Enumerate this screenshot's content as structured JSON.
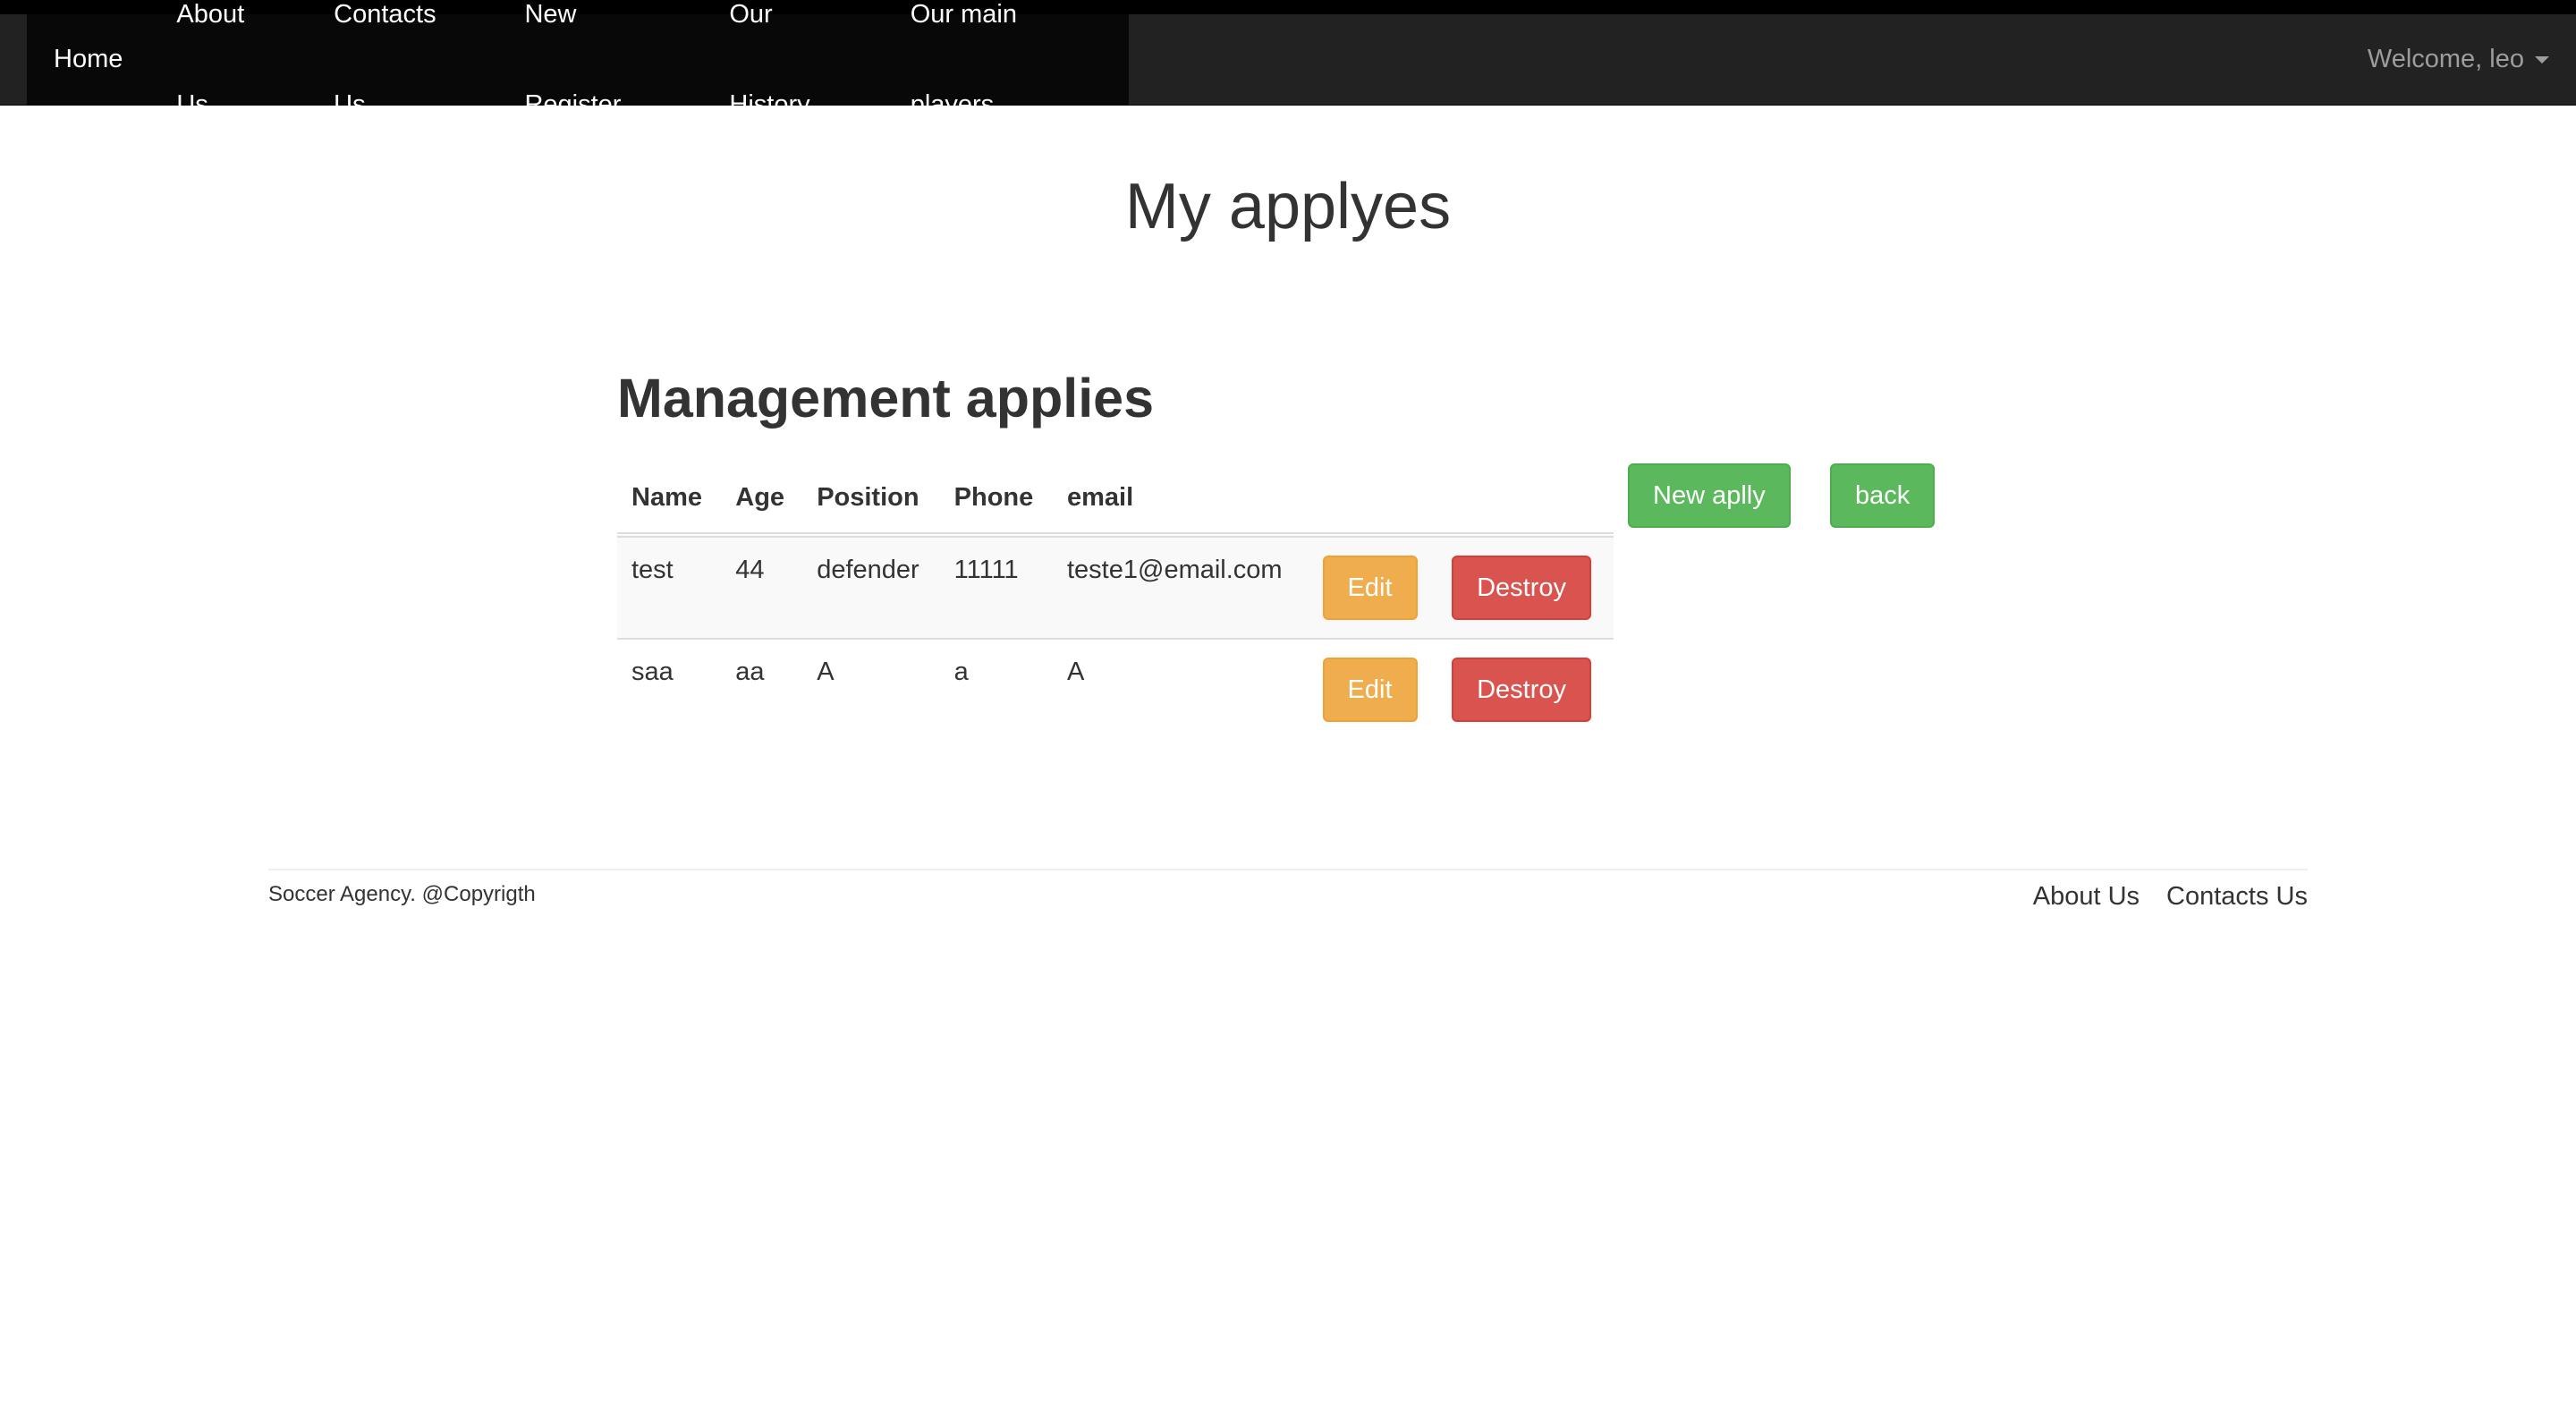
{
  "navbar": {
    "items": [
      "Home",
      "About Us",
      "Contacts Us",
      "New Register",
      "Our History",
      "Our main players"
    ],
    "welcome": "Welcome, leo"
  },
  "page_title": "My applyes",
  "section_title": "Management applies",
  "table": {
    "headers": [
      "Name",
      "Age",
      "Position",
      "Phone",
      "email"
    ],
    "rows": [
      {
        "name": "test",
        "age": "44",
        "position": "defender",
        "phone": "11111",
        "email": "teste1@email.com",
        "edit": "Edit",
        "destroy": "Destroy"
      },
      {
        "name": "saa",
        "age": "aa",
        "position": "A",
        "phone": "a",
        "email": "A",
        "edit": "Edit",
        "destroy": "Destroy"
      }
    ]
  },
  "actions": {
    "new_apply": "New aplly",
    "back": "back"
  },
  "footer": {
    "copyright": "Soccer Agency. @Copyrigth",
    "links": [
      "About Us",
      "Contacts Us"
    ]
  },
  "colors": {
    "navbar_bg": "#222222",
    "warning": "#f0ad4e",
    "danger": "#d9534f",
    "success": "#5cb85c"
  }
}
